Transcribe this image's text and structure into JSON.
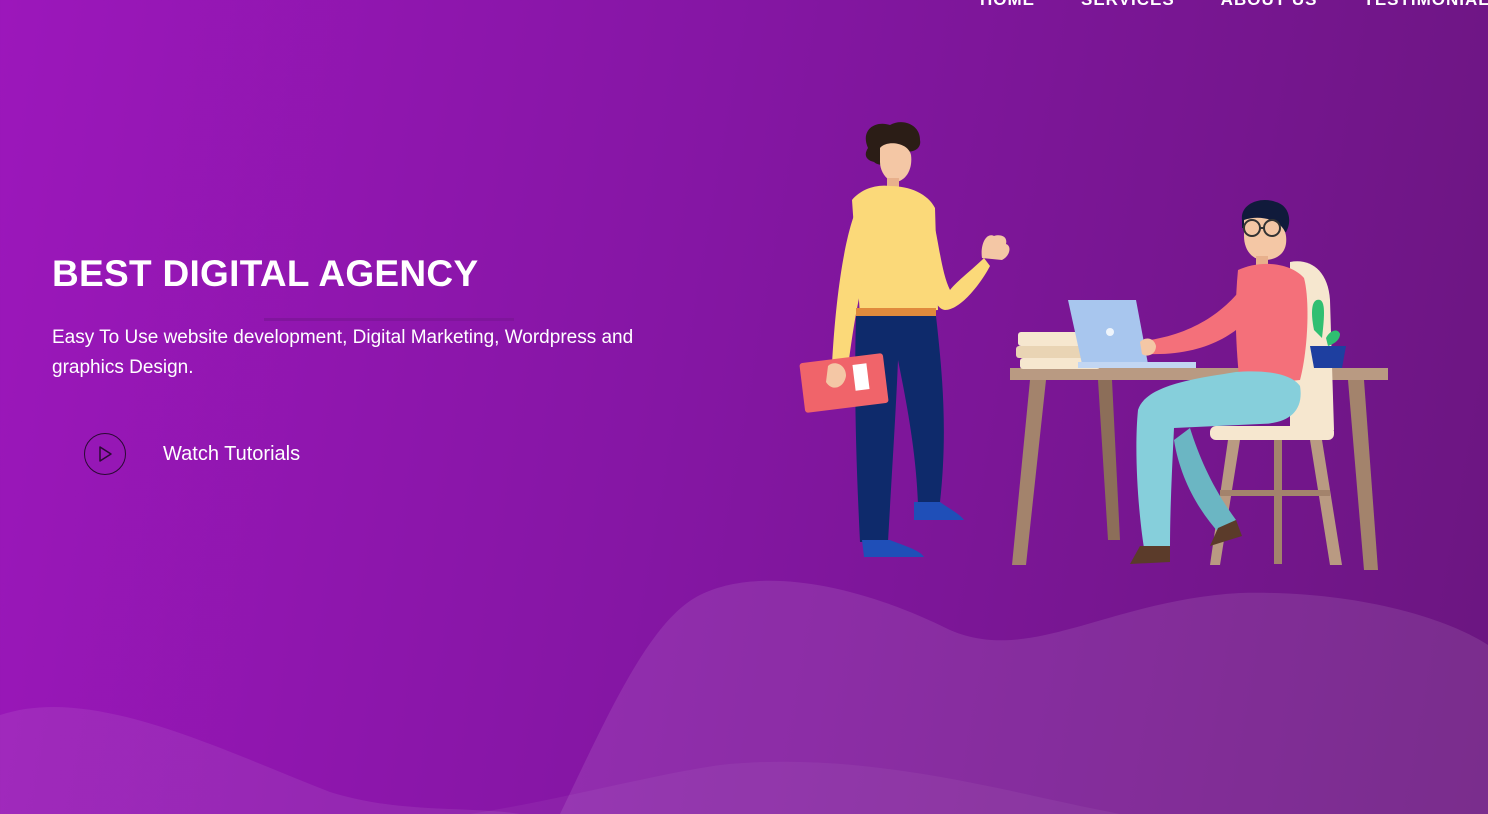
{
  "nav": {
    "items": [
      {
        "label": "HOME"
      },
      {
        "label": "SERVICES"
      },
      {
        "label": "ABOUT US"
      },
      {
        "label": "TESTIMONIALS"
      }
    ]
  },
  "hero": {
    "title": "BEST DIGITAL AGENCY",
    "description": "Easy To Use website development, Digital Marketing, Wordpress and graphics Design.",
    "cta": {
      "label": "Watch Tutorials",
      "icon": "play-circle-icon"
    }
  },
  "illustration": {
    "icon": "office-workers-illustration"
  },
  "colors": {
    "background_start": "#9c17bb",
    "background_end": "#6b1680",
    "text": "#ffffff"
  }
}
